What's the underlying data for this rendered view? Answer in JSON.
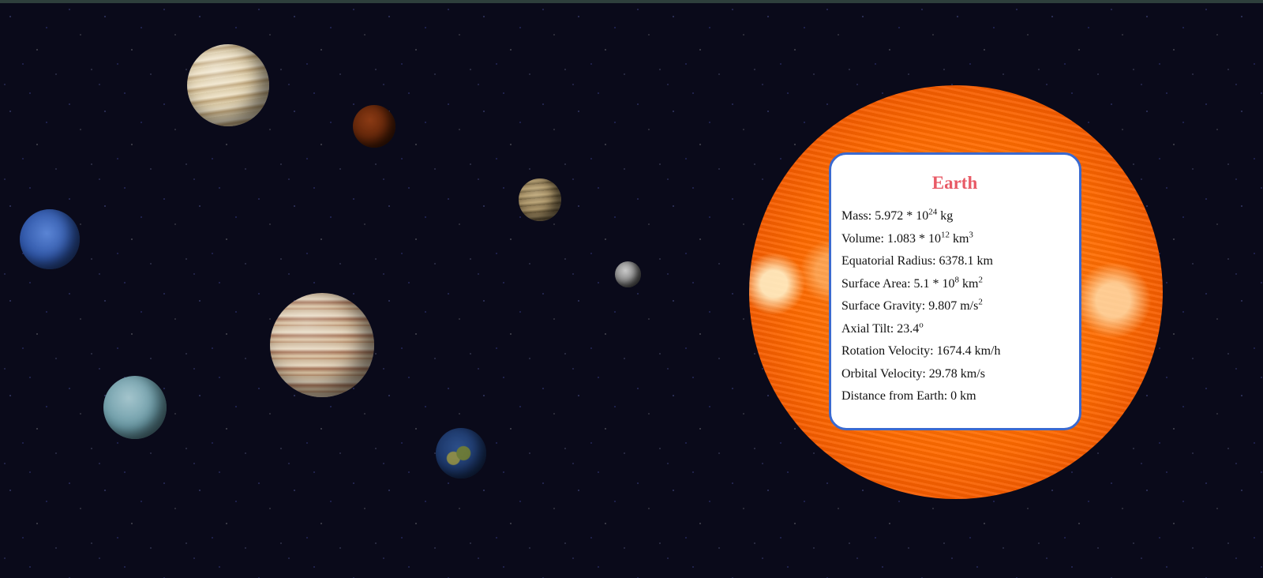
{
  "planet_card": {
    "title": "Earth",
    "mass": {
      "label": "Mass:",
      "value": "5.972 * 10",
      "exp": "24",
      "unit": "kg"
    },
    "volume": {
      "label": "Volume:",
      "value": "1.083 * 10",
      "exp": "12",
      "unit": "km",
      "unit_exp": "3"
    },
    "equatorial_radius": {
      "text": "Equatorial Radius: 6378.1 km"
    },
    "surface_area": {
      "label": "Surface Area:",
      "value": "5.1 * 10",
      "exp": "8",
      "unit": "km",
      "unit_exp": "2"
    },
    "surface_gravity": {
      "label": "Surface Gravity:",
      "value": "9.807 m/s",
      "unit_exp": "2"
    },
    "axial_tilt": {
      "label": "Axial Tilt:",
      "value": "23.4",
      "unit_exp": "o"
    },
    "rotation_velocity": {
      "text": "Rotation Velocity: 1674.4 km/h"
    },
    "orbital_velocity": {
      "text": "Orbital Velocity: 29.78 km/s"
    },
    "distance_from_earth": {
      "text": "Distance from Earth: 0 km"
    }
  },
  "colors": {
    "title": "#e85a66",
    "card_border": "#3a6ad0",
    "sun": "#ff6a00",
    "space": "#0a0a1a"
  },
  "planets": [
    {
      "name": "saturn"
    },
    {
      "name": "mars"
    },
    {
      "name": "venus"
    },
    {
      "name": "mercury"
    },
    {
      "name": "neptune"
    },
    {
      "name": "jupiter"
    },
    {
      "name": "uranus"
    },
    {
      "name": "earth"
    },
    {
      "name": "sun"
    }
  ]
}
